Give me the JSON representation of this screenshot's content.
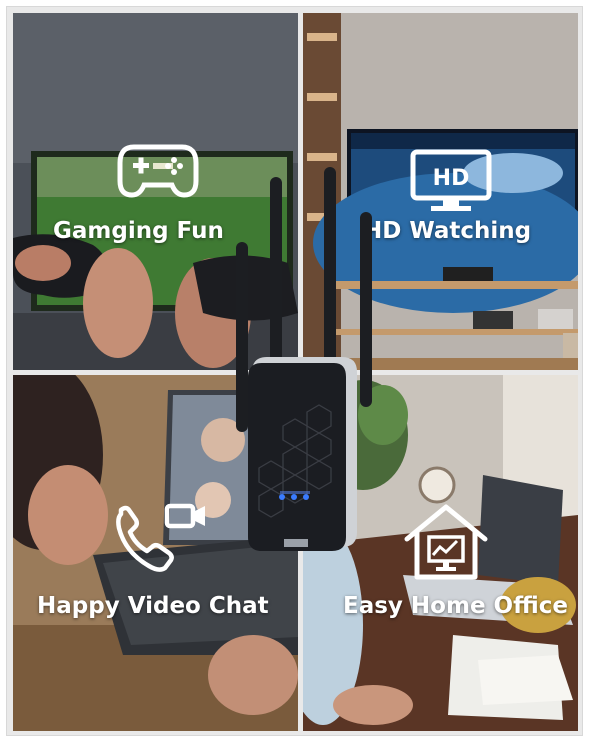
{
  "panels": [
    {
      "caption": "Gamging Fun",
      "icon": "gamepad-icon"
    },
    {
      "caption": "HD Watching",
      "icon": "hd-tv-icon",
      "icon_text": "HD"
    },
    {
      "caption": "Happy Video Chat",
      "icon": "phone-video-icon"
    },
    {
      "caption": "Easy Home Office",
      "icon": "home-office-icon"
    }
  ],
  "colors": {
    "caption": "#ffffff",
    "device_body": "#1b1d22",
    "device_led": "#3a7bff"
  }
}
